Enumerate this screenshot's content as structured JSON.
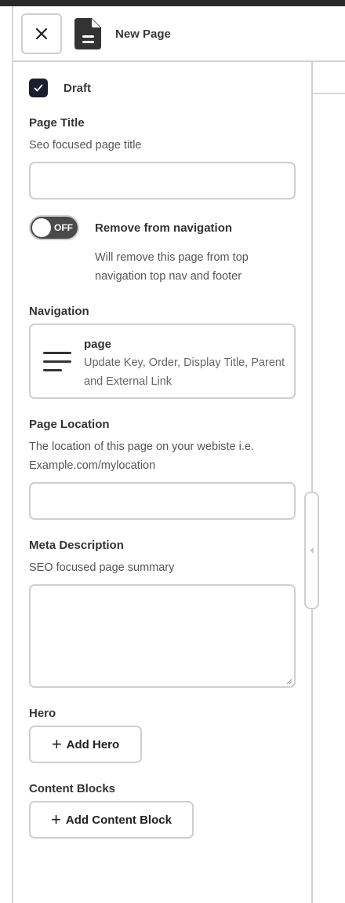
{
  "header": {
    "title": "New Page",
    "close_icon": "close-icon",
    "page_icon": "document-icon"
  },
  "draft": {
    "label": "Draft",
    "checked": true
  },
  "page_title": {
    "label": "Page Title",
    "hint": "Seo focused page title",
    "value": ""
  },
  "navigation_toggle": {
    "state_text": "OFF",
    "label": "Remove from navigation",
    "description": "Will remove this page from top navigation top nav and footer"
  },
  "navigation": {
    "label": "Navigation",
    "card_title": "page",
    "card_description": "Update Key, Order, Display Title, Parent and External Link",
    "icon": "menu-lines-icon"
  },
  "page_location": {
    "label": "Page Location",
    "hint": "The location of this page on your webiste i.e. Example.com/mylocation",
    "value": ""
  },
  "meta_description": {
    "label": "Meta Description",
    "hint": "SEO focused page summary",
    "value": ""
  },
  "hero": {
    "label": "Hero",
    "button_label": "Add Hero"
  },
  "content_blocks": {
    "label": "Content Blocks",
    "button_label": "Add Content Block"
  },
  "colors": {
    "accent_dark": "#1a1f2e",
    "border": "#cfcfcf",
    "toggle_off": "#4a4a4a"
  }
}
